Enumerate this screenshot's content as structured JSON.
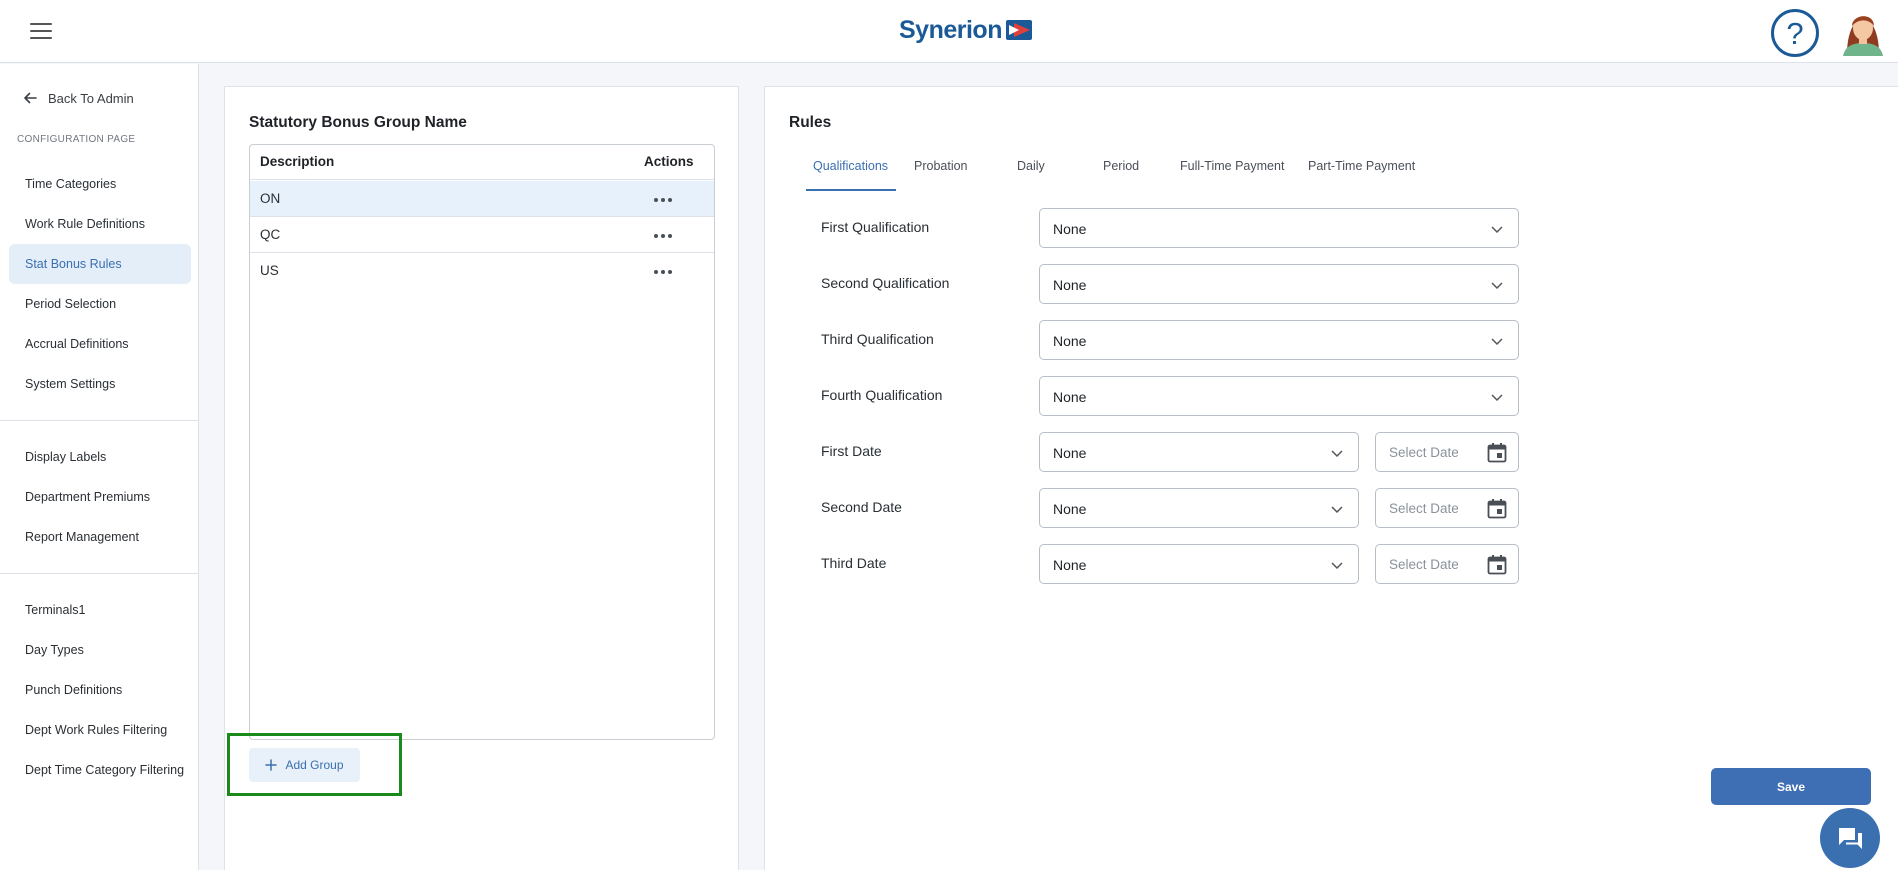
{
  "app": {
    "brand": "Synerion"
  },
  "sidebar": {
    "back_label": "Back To Admin",
    "section_title": "CONFIGURATION PAGE",
    "group1": [
      {
        "label": "Time Categories"
      },
      {
        "label": "Work Rule Definitions"
      },
      {
        "label": "Stat Bonus Rules",
        "active": true
      },
      {
        "label": "Period Selection"
      },
      {
        "label": "Accrual Definitions"
      },
      {
        "label": "System Settings"
      }
    ],
    "group2": [
      {
        "label": "Display Labels"
      },
      {
        "label": "Department Premiums"
      },
      {
        "label": "Report Management"
      }
    ],
    "group3": [
      {
        "label": "Terminals1"
      },
      {
        "label": "Day Types"
      },
      {
        "label": "Punch Definitions"
      },
      {
        "label": "Dept Work Rules Filtering"
      },
      {
        "label": "Dept Time Category Filtering"
      }
    ]
  },
  "groups_panel": {
    "title": "Statutory Bonus Group Name",
    "columns": [
      "Description",
      "Actions"
    ],
    "rows": [
      "ON",
      "QC",
      "US"
    ],
    "selected_row": "ON",
    "add_label": "Add Group"
  },
  "rules_panel": {
    "title": "Rules",
    "tabs": [
      "Qualifications",
      "Probation",
      "Daily",
      "Period",
      "Full-Time Payment",
      "Part-Time Payment"
    ],
    "active_tab": "Qualifications",
    "qualifications": [
      {
        "label": "First Qualification",
        "value": "None"
      },
      {
        "label": "Second Qualification",
        "value": "None"
      },
      {
        "label": "Third Qualification",
        "value": "None"
      },
      {
        "label": "Fourth Qualification",
        "value": "None"
      }
    ],
    "dates": [
      {
        "label": "First Date",
        "value": "None",
        "date_placeholder": "Select Date"
      },
      {
        "label": "Second Date",
        "value": "None",
        "date_placeholder": "Select Date"
      },
      {
        "label": "Third Date",
        "value": "None",
        "date_placeholder": "Select Date"
      }
    ],
    "save_label": "Save"
  },
  "colors": {
    "accent": "#3e6eb3",
    "brand": "#1b5a96",
    "highlight_box": "#1a8a1a",
    "selected_row": "#e6f1fb"
  }
}
